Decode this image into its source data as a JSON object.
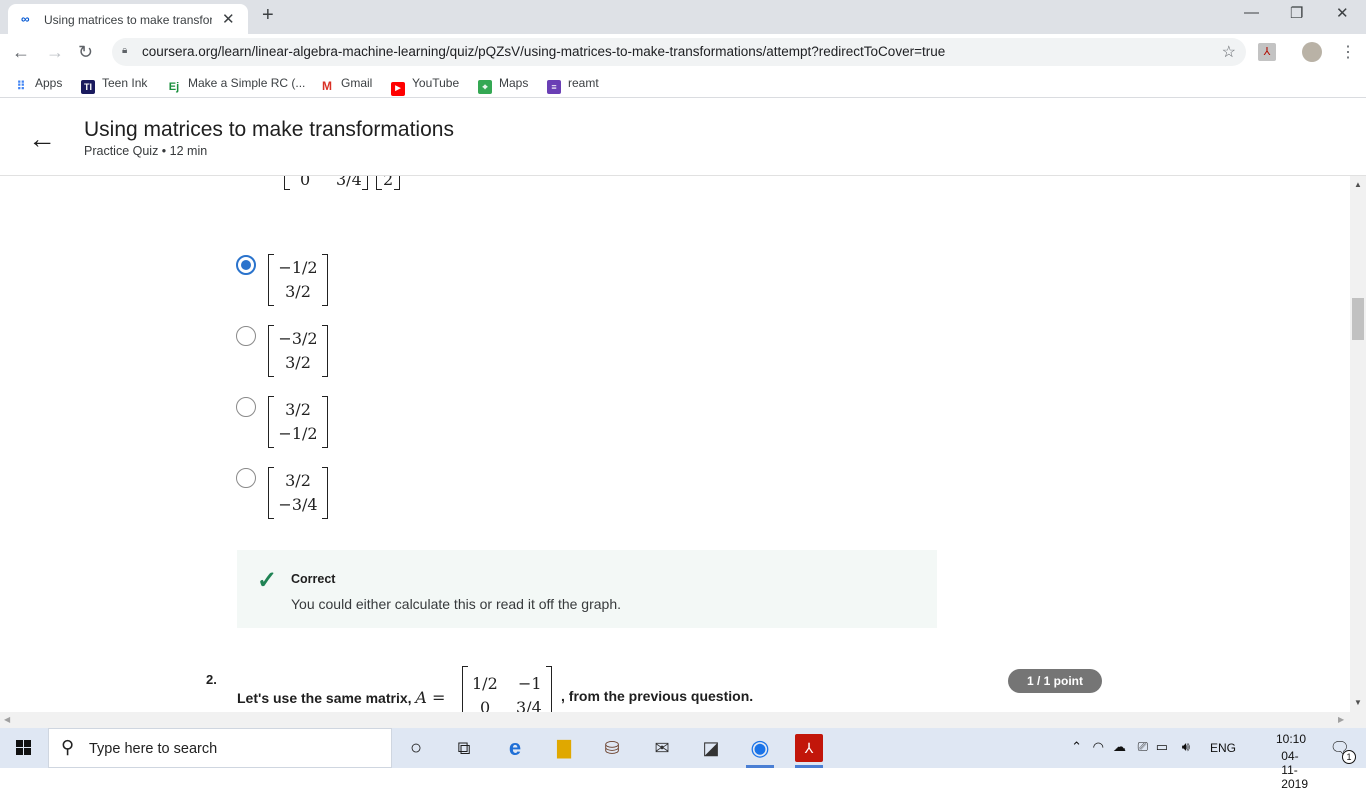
{
  "browser": {
    "tab_title": "Using matrices to make transform",
    "tab_close": "✕",
    "new_tab": "+",
    "url": "coursera.org/learn/linear-algebra-machine-learning/quiz/pQZsV/using-matrices-to-make-transformations/attempt?redirectToCover=true",
    "bookmarks": [
      {
        "label": "Apps",
        "icon": "apps-grid-icon",
        "color": "#4285f4"
      },
      {
        "label": "Teen Ink",
        "icon": "teen-ink-icon",
        "color": "#1a1a5e",
        "badge": "TI"
      },
      {
        "label": "Make a Simple RC (...",
        "icon": "ej-icon",
        "color": "#1a8f3c",
        "badge": "Ej"
      },
      {
        "label": "Gmail",
        "icon": "gmail-icon",
        "color": "#d93025",
        "badge": "M"
      },
      {
        "label": "YouTube",
        "icon": "youtube-icon",
        "color": "#ff0000",
        "badge": "▶"
      },
      {
        "label": "Maps",
        "icon": "maps-icon",
        "color": "#34a853",
        "badge": "⌖"
      },
      {
        "label": "reamt",
        "icon": "reamt-icon",
        "color": "#6a3fb5",
        "badge": "≡"
      }
    ]
  },
  "header": {
    "title": "Using matrices to make transformations",
    "subtitle": "Practice Quiz • 12 min"
  },
  "question1": {
    "partial_matrix": {
      "a": "0",
      "b": "3/4",
      "v": "2"
    },
    "options": [
      {
        "top": "−1/2",
        "bottom": "3/2",
        "selected": true
      },
      {
        "top": "−3/2",
        "bottom": "3/2",
        "selected": false
      },
      {
        "top": "3/2",
        "bottom": "−1/2",
        "selected": false
      },
      {
        "top": "3/2",
        "bottom": "−3/4",
        "selected": false
      }
    ],
    "feedback": {
      "status": "Correct",
      "message": "You could either calculate this or read it off the graph."
    }
  },
  "question2": {
    "number": "2.",
    "points": "1 / 1 point",
    "text_before": "Let's use the same matrix,",
    "var": "A =",
    "matrix": {
      "r1c1": "1/2",
      "r1c2": "−1",
      "r2c1": "0",
      "r2c2": "3/4"
    },
    "text_after": ", from the previous question."
  },
  "taskbar": {
    "search_placeholder": "Type here to search",
    "lang": "ENG",
    "time": "10:10",
    "date": "04-11-2019",
    "notifications": "1"
  },
  "colors": {
    "accent": "#2a73cc",
    "correct": "#1f8354",
    "feedback_bg": "#f3f8f6"
  }
}
